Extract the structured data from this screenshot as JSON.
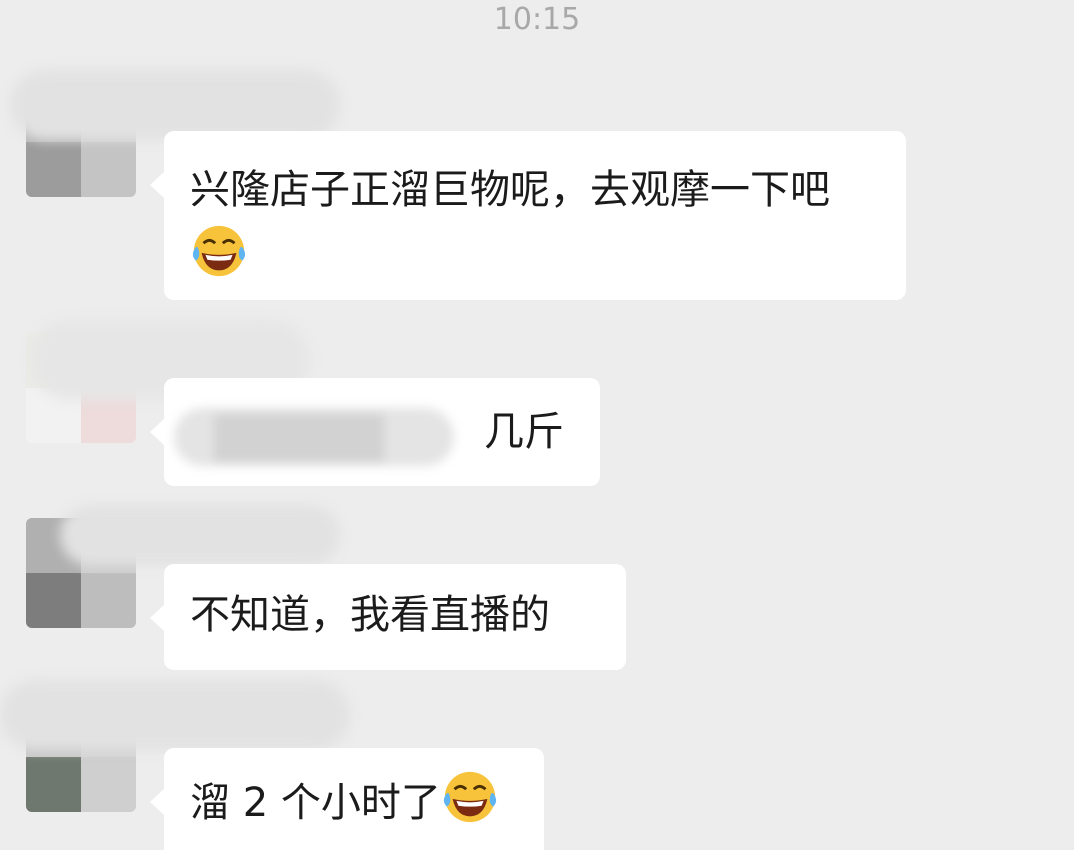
{
  "status": {
    "time": "10:15"
  },
  "messages": [
    {
      "text": "兴隆店子正溜巨物呢，去观摩一下吧",
      "emoji": "laughing-tears"
    },
    {
      "text": "几斤"
    },
    {
      "text": "不知道，我看直播的"
    },
    {
      "text": "溜 2 个小时了",
      "emoji": "laughing-tears"
    }
  ],
  "colors": {
    "background": "#ededed",
    "bubble": "#ffffff",
    "timestamp": "#a8a8a8"
  }
}
